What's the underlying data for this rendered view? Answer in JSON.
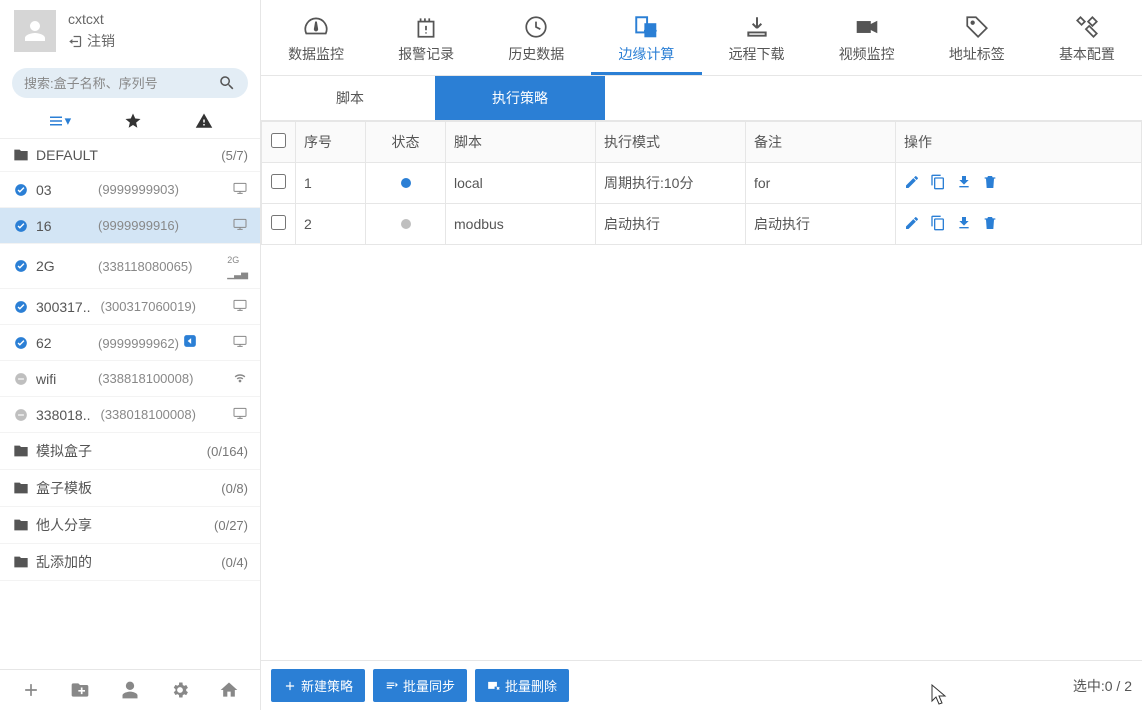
{
  "user": {
    "name": "cxtcxt",
    "logout_label": "注销"
  },
  "search": {
    "placeholder": "搜索:盒子名称、序列号"
  },
  "sections": [
    {
      "icon": "folder",
      "label": "DEFAULT",
      "count": "(5/7)"
    }
  ],
  "devices": [
    {
      "status": "online",
      "label": "03",
      "code": "(9999999903)",
      "right": "monitor"
    },
    {
      "status": "online",
      "label": "16",
      "code": "(9999999916)",
      "right": "monitor",
      "selected": true
    },
    {
      "status": "online",
      "label": "2G",
      "code": "(338118080065)",
      "right": "signal"
    },
    {
      "status": "online",
      "label": "300317..",
      "code": "(300317060019)",
      "right": "monitor"
    },
    {
      "status": "online",
      "label": "62",
      "code": "(9999999962)",
      "right": "monitor",
      "share": true
    },
    {
      "status": "offline",
      "label": "wifi",
      "code": "(338818100008)",
      "right": "wifi"
    },
    {
      "status": "offline",
      "label": "338018..",
      "code": "(338018100008)",
      "right": "monitor"
    }
  ],
  "folders": [
    {
      "label": "模拟盒子",
      "count": "(0/164)"
    },
    {
      "label": "盒子模板",
      "count": "(0/8)"
    },
    {
      "label": "他人分享",
      "count": "(0/27)"
    },
    {
      "label": "乱添加的",
      "count": "(0/4)"
    }
  ],
  "topnav": [
    {
      "id": "data-monitor",
      "label": "数据监控",
      "icon": "gauge"
    },
    {
      "id": "alarm-record",
      "label": "报警记录",
      "icon": "alarm"
    },
    {
      "id": "history-data",
      "label": "历史数据",
      "icon": "history"
    },
    {
      "id": "edge-compute",
      "label": "边缘计算",
      "icon": "edge",
      "active": true
    },
    {
      "id": "remote-download",
      "label": "远程下载",
      "icon": "download"
    },
    {
      "id": "video-monitor",
      "label": "视频监控",
      "icon": "video"
    },
    {
      "id": "address-tag",
      "label": "地址标签",
      "icon": "tag"
    },
    {
      "id": "basic-config",
      "label": "基本配置",
      "icon": "tools"
    }
  ],
  "subtabs": [
    {
      "id": "script",
      "label": "脚本"
    },
    {
      "id": "policy",
      "label": "执行策略",
      "active": true
    }
  ],
  "table": {
    "headers": {
      "index": "序号",
      "status": "状态",
      "script": "脚本",
      "mode": "执行模式",
      "remark": "备注",
      "ops": "操作"
    },
    "rows": [
      {
        "index": "1",
        "status_color": "#2b7fd5",
        "script": "local",
        "mode": "周期执行:10分",
        "remark": "for"
      },
      {
        "index": "2",
        "status_color": "#bfbfbf",
        "script": "modbus",
        "mode": "启动执行",
        "remark": "启动执行"
      }
    ]
  },
  "footer": {
    "new_policy": "新建策略",
    "batch_sync": "批量同步",
    "batch_delete": "批量删除",
    "selected": "选中:0 / 2"
  }
}
